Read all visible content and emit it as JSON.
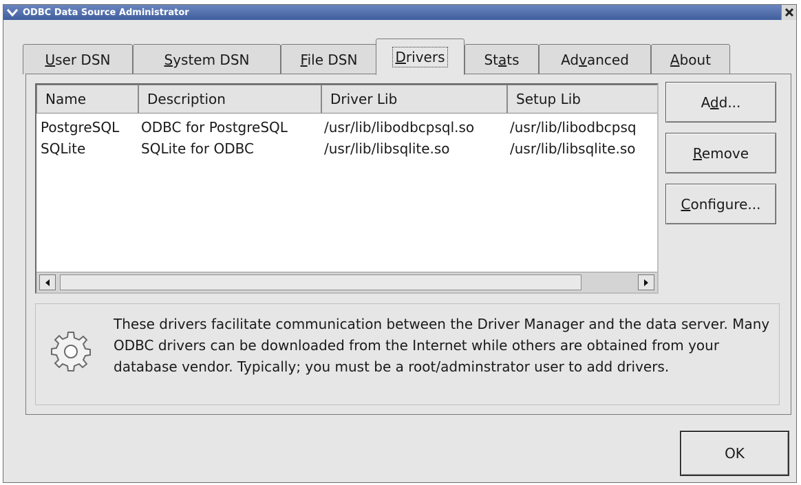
{
  "window": {
    "title": "ODBC Data Source Administrator"
  },
  "tabs": [
    {
      "label_pre": "",
      "label_key": "U",
      "label_post": "ser DSN"
    },
    {
      "label_pre": "",
      "label_key": "S",
      "label_post": "ystem DSN"
    },
    {
      "label_pre": "",
      "label_key": "F",
      "label_post": "ile DSN"
    },
    {
      "label_pre": "",
      "label_key": "D",
      "label_post": "rivers"
    },
    {
      "label_pre": "St",
      "label_key": "a",
      "label_post": "ts"
    },
    {
      "label_pre": "Ad",
      "label_key": "v",
      "label_post": "anced"
    },
    {
      "label_pre": "",
      "label_key": "A",
      "label_post": "bout"
    }
  ],
  "active_tab": "Drivers",
  "drivers_table": {
    "columns": [
      "Name",
      "Description",
      "Driver Lib",
      "Setup Lib"
    ],
    "rows": [
      [
        "PostgreSQL",
        "ODBC for PostgreSQL",
        "/usr/lib/libodbcpsql.so",
        "/usr/lib/libodbcpsq"
      ],
      [
        "SQLite",
        "SQLite for ODBC",
        "/usr/lib/libsqlite.so",
        "/usr/lib/libsqlite.so"
      ]
    ]
  },
  "buttons": {
    "add": {
      "pre": "A",
      "key": "d",
      "post": "d..."
    },
    "remove": {
      "pre": "",
      "key": "R",
      "post": "emove"
    },
    "configure": {
      "pre": "",
      "key": "C",
      "post": "onfigure..."
    },
    "ok": "OK"
  },
  "info": {
    "icon": "gear-icon",
    "message": "These drivers facilitate communication between the Driver Manager and the data server. Many ODBC drivers can be downloaded from the Internet while others are obtained from your database vendor. Typically; you must be a root/adminstrator user to add drivers."
  }
}
